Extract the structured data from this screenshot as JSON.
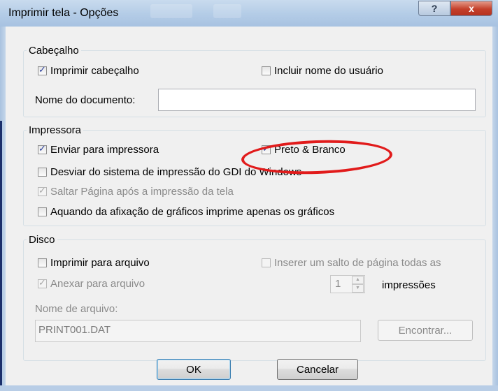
{
  "window": {
    "title": "Imprimir tela - Opções",
    "help_glyph": "?",
    "close_glyph": "x"
  },
  "cabecalho": {
    "legend": "Cabeçalho",
    "imprimir_cabecalho": {
      "label": "Imprimir cabeçalho",
      "checked": true
    },
    "incluir_usuario": {
      "label": "Incluir nome do usuário",
      "checked": false
    },
    "nome_documento_label": "Nome do documento:",
    "nome_documento_value": ""
  },
  "impressora": {
    "legend": "Impressora",
    "enviar": {
      "label": "Enviar para impressora",
      "checked": true
    },
    "preto_branco": {
      "label": "Preto & Branco",
      "checked": true
    },
    "desviar": {
      "label": "Desviar do sistema de impressão do GDI do Windows",
      "checked": false
    },
    "saltar": {
      "label": "Saltar Página após a impressão da tela",
      "checked": true,
      "disabled": true
    },
    "aquando": {
      "label": "Aquando da afixação de gráficos imprime apenas os gráficos",
      "checked": false
    }
  },
  "disco": {
    "legend": "Disco",
    "imprimir_arquivo": {
      "label": "Imprimir para arquivo",
      "checked": false
    },
    "anexar": {
      "label": "Anexar para arquivo",
      "checked": true,
      "disabled": true
    },
    "inserir_salto": {
      "label": "Inserer um salto de página todas as",
      "checked": false,
      "disabled": true
    },
    "spinner_value": "1",
    "impressoes_label": "impressões",
    "nome_arquivo_label": "Nome de arquivo:",
    "nome_arquivo_value": "PRINT001.DAT",
    "encontrar_label": "Encontrar..."
  },
  "buttons": {
    "ok": "OK",
    "cancel": "Cancelar"
  },
  "colors": {
    "highlight_ellipse": "#e11b1b",
    "check": "#2b3f9c",
    "titlebar": "#b5cde7"
  }
}
